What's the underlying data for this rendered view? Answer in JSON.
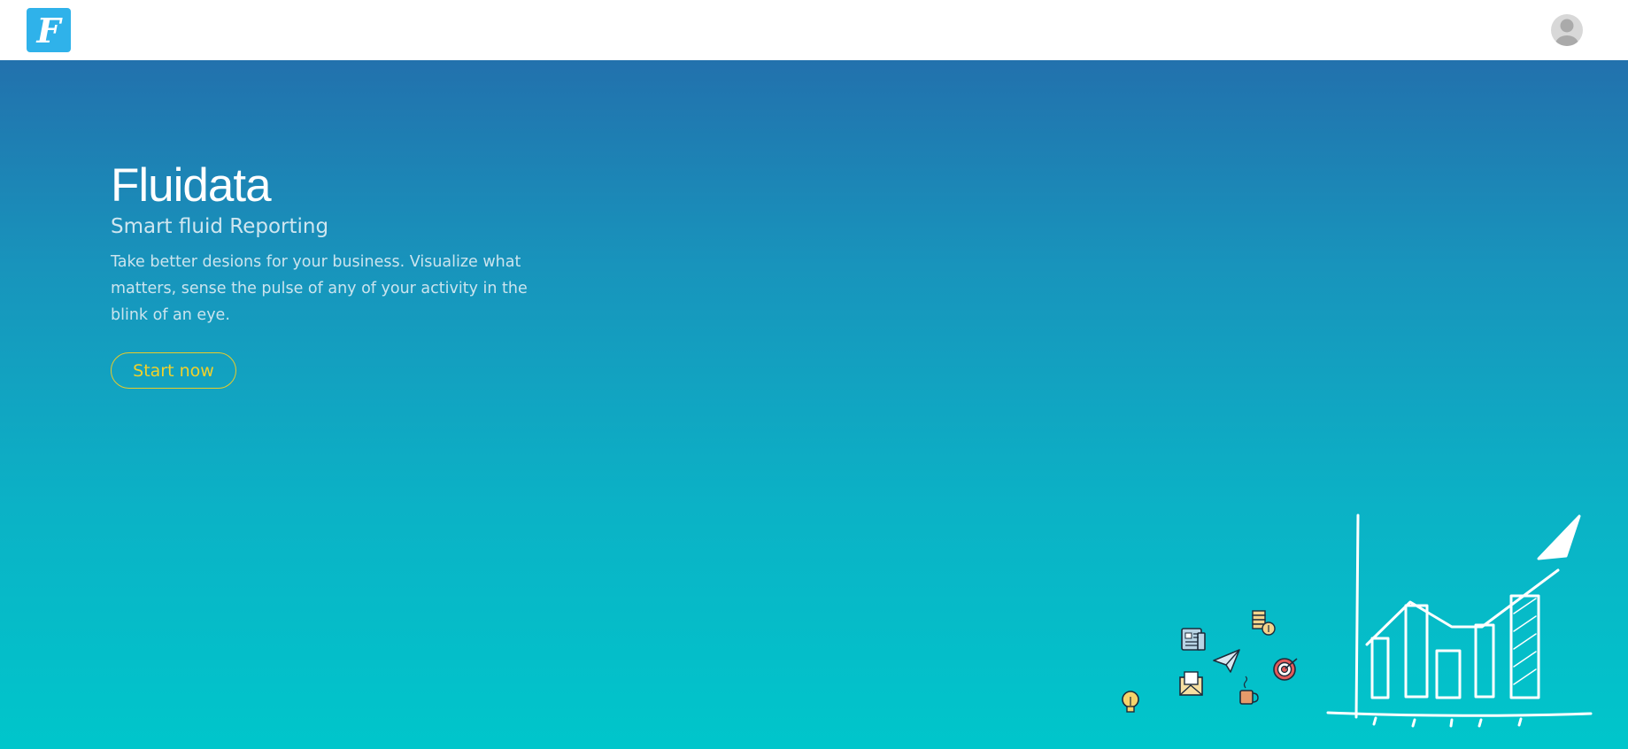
{
  "app": {
    "logo_letter": "F",
    "logo_color": "#2fb2ea"
  },
  "topbar": {
    "avatar_icon": "user-avatar-icon"
  },
  "hero": {
    "title": "Fluidata",
    "subtitle": "Smart fluid Reporting",
    "description": "Take better desions for your business. Visualize what matters, sense the pulse of any of your activity in the blink of an eye.",
    "cta_label": "Start now",
    "cta_color": "#f1d12a",
    "gradient_top": "#2271ad",
    "gradient_bottom": "#00c6cb"
  },
  "illustration": {
    "icons": [
      "newspaper-icon",
      "coins-icon",
      "paper-plane-icon",
      "target-icon",
      "envelope-icon",
      "coffee-cup-icon",
      "lightbulb-icon",
      "growth-chart-icon"
    ]
  }
}
